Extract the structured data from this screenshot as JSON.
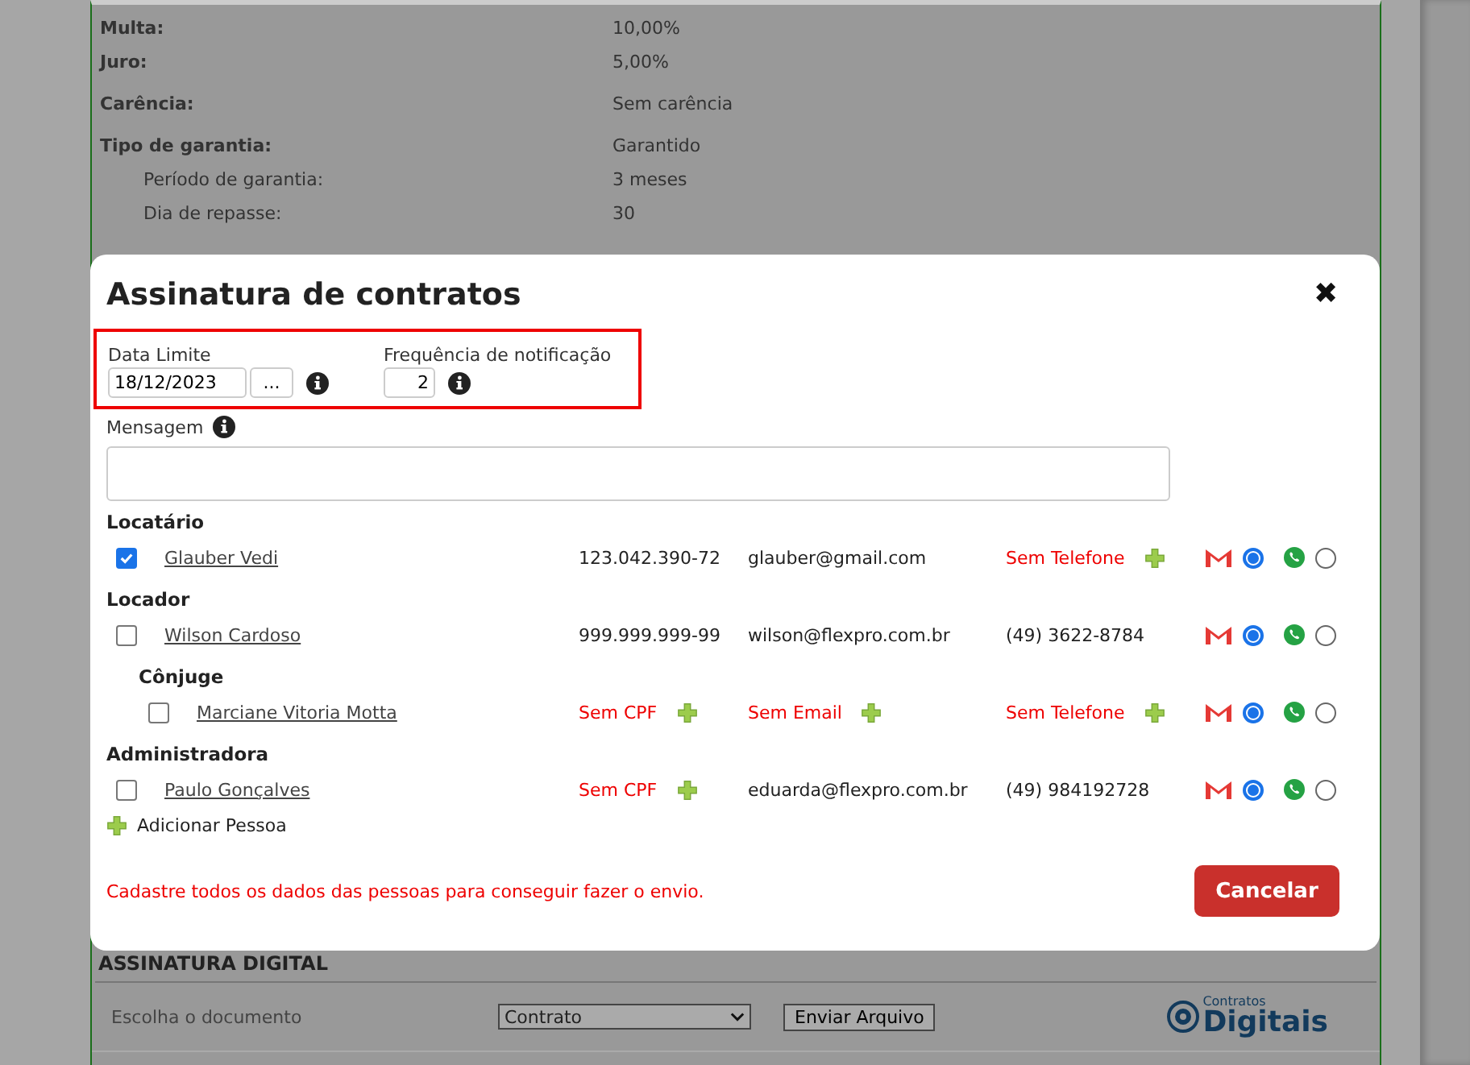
{
  "background_page": {
    "details": [
      {
        "label": "Multa:",
        "value": "10,00%",
        "indented": false
      },
      {
        "label": "Juro:",
        "value": "5,00%",
        "indented": false
      },
      {
        "label": "Carência:",
        "value": "Sem carência",
        "indented": false
      },
      {
        "label": "Tipo de garantia:",
        "value": "Garantido",
        "indented": false
      },
      {
        "label": "Período de garantia:",
        "value": "3 meses",
        "indented": true
      },
      {
        "label": "Dia de repasse:",
        "value": "30",
        "indented": true
      }
    ],
    "section_title": "ASSINATURA DIGITAL",
    "document_label": "Escolha o documento",
    "document_select": "Contrato",
    "send_button": "Enviar Arquivo",
    "logo": {
      "small": "Contratos",
      "big": "Digitais"
    }
  },
  "dialog": {
    "title": "Assinatura de contratos",
    "close": "✖",
    "date_limit": {
      "label": "Data Limite",
      "value": "18/12/2023",
      "picker": "..."
    },
    "frequency": {
      "label": "Frequência de notificação",
      "value": "2"
    },
    "message": {
      "label": "Mensagem"
    },
    "groups": [
      {
        "title": "Locatário",
        "people": [
          {
            "name": "Glauber Vedi",
            "checked": true,
            "cpf": {
              "text": "123.042.390-72",
              "missing": false
            },
            "email": {
              "text": "glauber@gmail.com",
              "missing": false
            },
            "phone": {
              "text": "Sem Telefone",
              "missing": true
            },
            "email_selected": true,
            "whatsapp_selected": false
          }
        ]
      },
      {
        "title": "Locador",
        "people": [
          {
            "name": "Wilson Cardoso",
            "checked": false,
            "cpf": {
              "text": "999.999.999-99",
              "missing": false
            },
            "email": {
              "text": "wilson@flexpro.com.br",
              "missing": false
            },
            "phone": {
              "text": "(49) 3622-8784",
              "missing": false
            },
            "email_selected": true,
            "whatsapp_selected": false
          }
        ],
        "children": [
          {
            "title": "Cônjuge",
            "people": [
              {
                "name": "Marciane Vitoria Motta",
                "checked": false,
                "cpf": {
                  "text": "Sem CPF",
                  "missing": true
                },
                "email": {
                  "text": "Sem Email",
                  "missing": true
                },
                "phone": {
                  "text": "Sem Telefone",
                  "missing": true
                },
                "email_selected": true,
                "whatsapp_selected": false
              }
            ]
          }
        ]
      },
      {
        "title": "Administradora",
        "people": [
          {
            "name": "Paulo Gonçalves",
            "checked": false,
            "cpf": {
              "text": "Sem CPF",
              "missing": true
            },
            "email": {
              "text": "eduarda@flexpro.com.br",
              "missing": false
            },
            "phone": {
              "text": "(49) 984192728",
              "missing": false
            },
            "email_selected": true,
            "whatsapp_selected": false
          }
        ]
      }
    ],
    "add_person": "Adicionar Pessoa",
    "warning": "Cadastre todos os dados das pessoas para conseguir fazer o envio.",
    "cancel": "Cancelar"
  }
}
